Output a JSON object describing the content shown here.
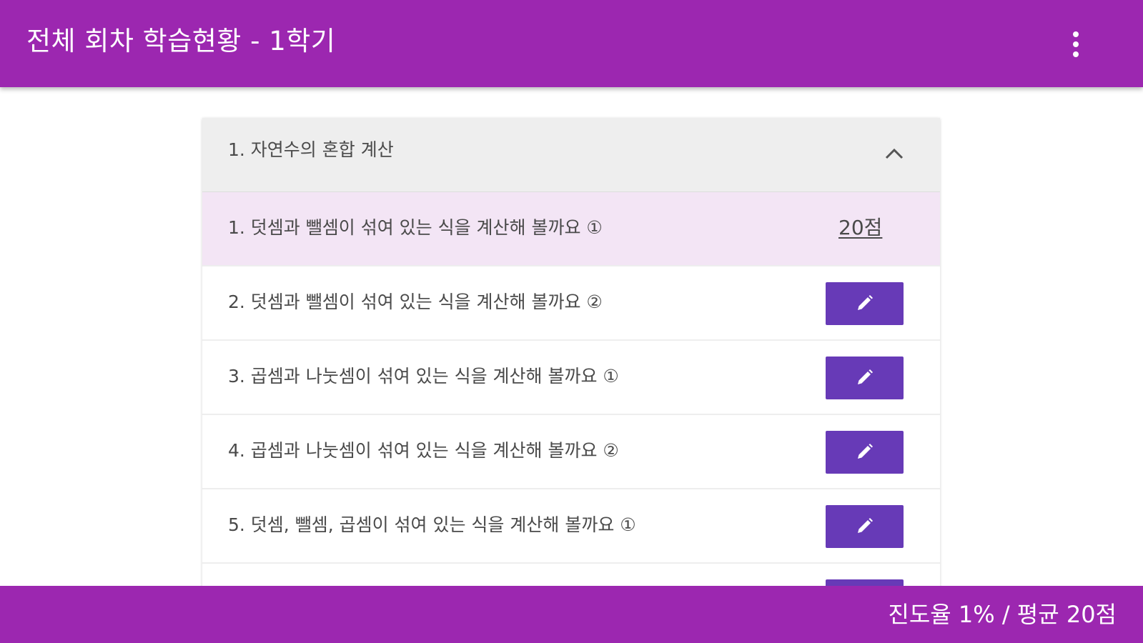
{
  "header": {
    "title": "전체 회차 학습현황 - 1학기",
    "menu_icon": "more-vert-icon"
  },
  "section": {
    "title": "1. 자연수의 혼합 계산",
    "expanded": true,
    "toggle_icon": "chevron-up-icon"
  },
  "lessons": [
    {
      "label": "1. 덧셈과 뺄셈이 섞여 있는 식을 계산해 볼까요 ①",
      "score": "20점",
      "completed": true
    },
    {
      "label": "2. 덧셈과 뺄셈이 섞여 있는 식을 계산해 볼까요 ②",
      "action_icon": "pencil-icon",
      "completed": false
    },
    {
      "label": "3. 곱셈과 나눗셈이 섞여 있는 식을 계산해 볼까요 ①",
      "action_icon": "pencil-icon",
      "completed": false
    },
    {
      "label": "4. 곱셈과 나눗셈이 섞여 있는 식을 계산해 볼까요 ②",
      "action_icon": "pencil-icon",
      "completed": false
    },
    {
      "label": "5. 덧셈, 뺄셈, 곱셈이 섞여 있는 식을 계산해 볼까요 ①",
      "action_icon": "pencil-icon",
      "completed": false
    }
  ],
  "footer": {
    "status": "진도율 1% / 평균 20점"
  },
  "colors": {
    "primary": "#9c27b0",
    "accent": "#673ab7",
    "active_row": "#f3e5f5",
    "section_header": "#eeeeee"
  }
}
